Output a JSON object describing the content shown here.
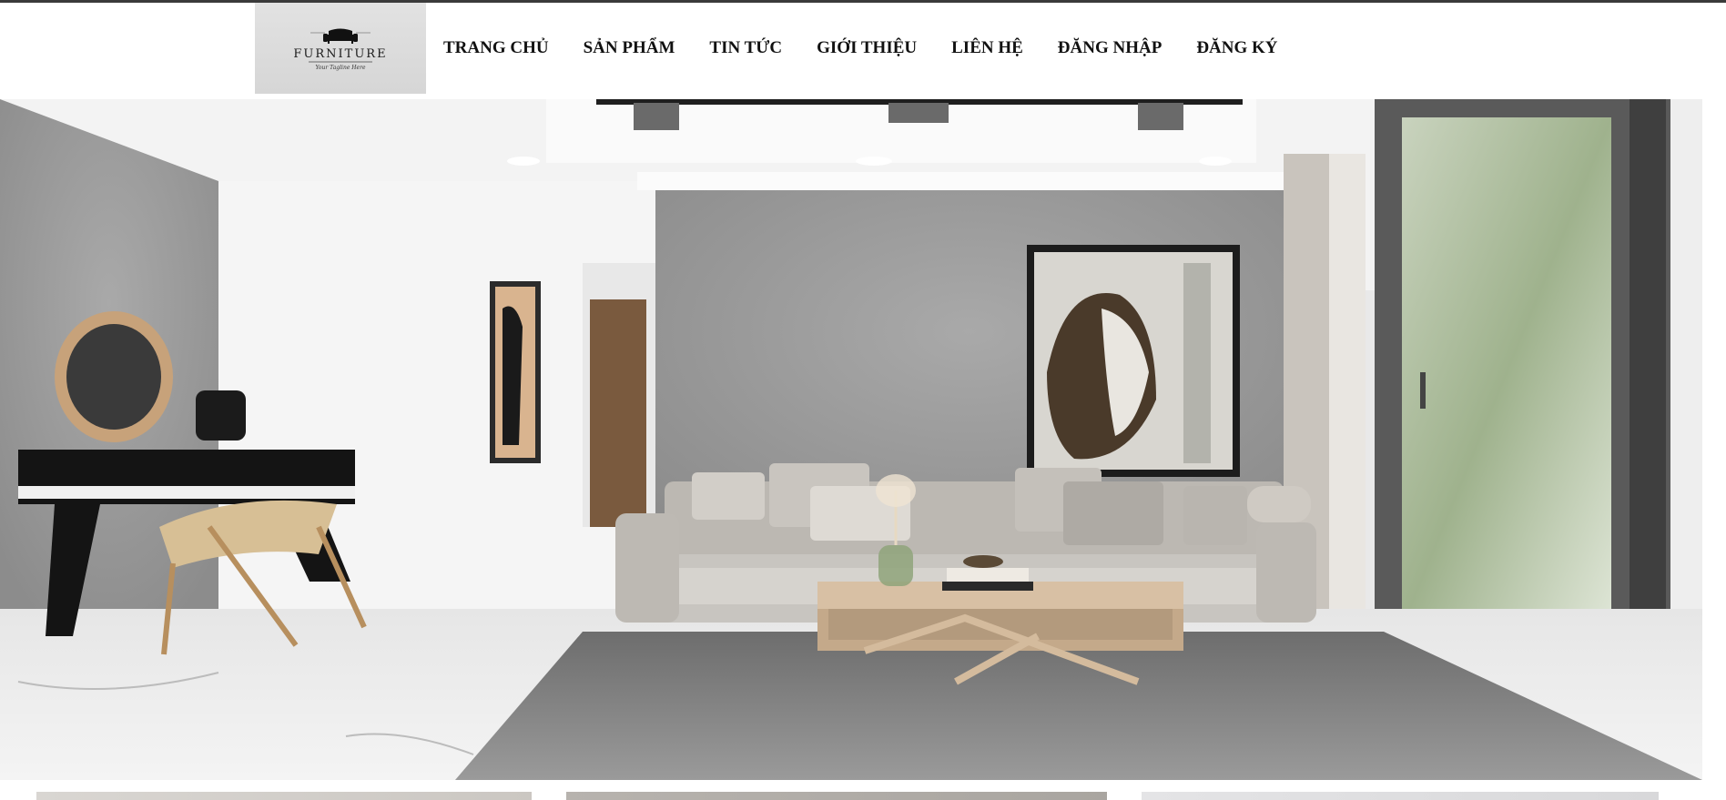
{
  "brand": {
    "logo_text": "FURNITURE",
    "logo_tagline": "Your Tagline Here"
  },
  "nav": {
    "items": [
      {
        "label": "TRANG CHỦ"
      },
      {
        "label": "SẢN PHẨM"
      },
      {
        "label": "TIN TỨC"
      },
      {
        "label": "GIỚI THIỆU"
      },
      {
        "label": "LIÊN HỆ"
      },
      {
        "label": "ĐĂNG NHẬP"
      },
      {
        "label": "ĐĂNG KÝ"
      }
    ]
  },
  "colors": {
    "topbar": "#3a3a3a",
    "nav_text": "#111111",
    "logo_bg": "#dcdcdc"
  }
}
